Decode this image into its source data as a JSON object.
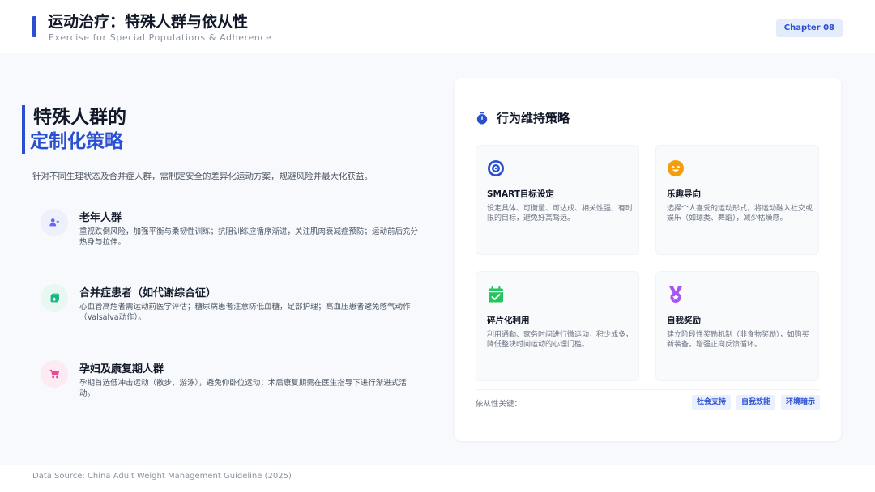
{
  "header": {
    "title": "运动治疗：特殊人群与依从性",
    "subtitle": "Exercise for Special Populations & Adherence",
    "chapter": "Chapter 08"
  },
  "left": {
    "heading_line1": "特殊人群的",
    "heading_line2": "定制化策略",
    "intro": "针对不同生理状态及合并症人群，需制定安全的差异化运动方案，规避风险并最大化获益。",
    "groups": [
      {
        "title": "老年人群",
        "desc": "重视跌倒风险，加强平衡与柔韧性训练；抗阻训练应循序渐进，关注肌肉衰减症预防；运动前后充分热身与拉伸。",
        "icon": "users-icon",
        "color": "#6366f1",
        "bg": "#eef0fb"
      },
      {
        "title": "合并症患者（如代谢综合征）",
        "desc": "心血管高危者需运动前医学评估；糖尿病患者注意防低血糖，足部护理；高血压患者避免憋气动作（Valsalva动作）。",
        "icon": "clipboard-medical-icon",
        "color": "#10b981",
        "bg": "#e8f7f1"
      },
      {
        "title": "孕妇及康复期人群",
        "desc": "孕期首选低冲击运动（散步、游泳），避免仰卧位运动；术后康复期需在医生指导下进行渐进式活动。",
        "icon": "stroller-icon",
        "color": "#ec4899",
        "bg": "#fcebf3"
      }
    ]
  },
  "strategies": {
    "title": "行为维持策略",
    "icon": "stopwatch-icon",
    "items": [
      {
        "title": "SMART目标设定",
        "desc": "设定具体、可衡量、可达成、相关性强、有时限的目标，避免好高骛远。",
        "icon": "target-icon",
        "color": "#2b4fd1"
      },
      {
        "title": "乐趣导向",
        "desc": "选择个人喜爱的运动形式，将运动融入社交或娱乐（如球类、舞蹈），减少枯燥感。",
        "icon": "smile-icon",
        "color": "#f59e0b"
      },
      {
        "title": "碎片化利用",
        "desc": "利用通勤、家务时间进行微运动，积少成多，降低整块时间运动的心理门槛。",
        "icon": "calendar-check-icon",
        "color": "#22c55e"
      },
      {
        "title": "自我奖励",
        "desc": "建立阶段性奖励机制（非食物奖励），如购买新装备，增强正向反馈循环。",
        "icon": "medal-icon",
        "color": "#a855f7"
      }
    ],
    "keys_label": "依从性关键：",
    "tags": [
      "社会支持",
      "自我效能",
      "环境暗示"
    ]
  },
  "source": "Data Source: China Adult Weight Management Guideline (2025)"
}
